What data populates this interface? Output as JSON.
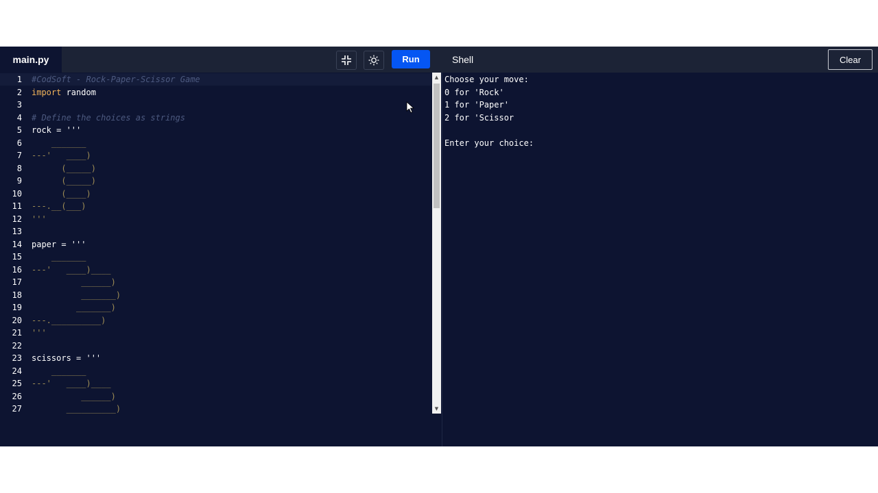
{
  "editor": {
    "file_name": "main.py",
    "lines": [
      {
        "n": "1",
        "t": "#CodSoft - Rock-Paper-Scissor Game",
        "k": "comment",
        "active": true
      },
      {
        "n": "2",
        "t": "",
        "k": "import"
      },
      {
        "n": "3",
        "t": "",
        "k": "plain"
      },
      {
        "n": "4",
        "t": "# Define the choices as strings",
        "k": "comment"
      },
      {
        "n": "5",
        "t": "rock = '''",
        "k": "assign"
      },
      {
        "n": "6",
        "t": "    _______",
        "k": "str"
      },
      {
        "n": "7",
        "t": "---'   ____)",
        "k": "str"
      },
      {
        "n": "8",
        "t": "      (_____)",
        "k": "str"
      },
      {
        "n": "9",
        "t": "      (_____)",
        "k": "str"
      },
      {
        "n": "10",
        "t": "      (____)",
        "k": "str"
      },
      {
        "n": "11",
        "t": "---.__(___)",
        "k": "str"
      },
      {
        "n": "12",
        "t": "'''",
        "k": "str"
      },
      {
        "n": "13",
        "t": "",
        "k": "plain"
      },
      {
        "n": "14",
        "t": "paper = '''",
        "k": "assign"
      },
      {
        "n": "15",
        "t": "    _______",
        "k": "str"
      },
      {
        "n": "16",
        "t": "---'   ____)____",
        "k": "str"
      },
      {
        "n": "17",
        "t": "          ______)",
        "k": "str"
      },
      {
        "n": "18",
        "t": "          _______)",
        "k": "str"
      },
      {
        "n": "19",
        "t": "         _______)",
        "k": "str"
      },
      {
        "n": "20",
        "t": "---.__________)",
        "k": "str"
      },
      {
        "n": "21",
        "t": "'''",
        "k": "str"
      },
      {
        "n": "22",
        "t": "",
        "k": "plain"
      },
      {
        "n": "23",
        "t": "scissors = '''",
        "k": "assign"
      },
      {
        "n": "24",
        "t": "    _______",
        "k": "str"
      },
      {
        "n": "25",
        "t": "---'   ____)____",
        "k": "str"
      },
      {
        "n": "26",
        "t": "          ______)",
        "k": "str"
      },
      {
        "n": "27",
        "t": "       __________)",
        "k": "str"
      }
    ],
    "import_keyword": "import",
    "import_module": " random"
  },
  "toolbar": {
    "run_label": "Run",
    "shell_title": "Shell",
    "clear_label": "Clear",
    "icons": [
      "minimize-icon",
      "theme-sun-icon"
    ]
  },
  "shell": {
    "output": [
      "Choose your move:",
      "0 for 'Rock'",
      "1 for 'Paper'",
      "2 for 'Scissor",
      "",
      "Enter your choice:"
    ]
  },
  "colors": {
    "background": "#0d1431",
    "header": "#1c2336",
    "run_button": "#0556f3",
    "keyword": "#f2b45a",
    "comment": "#4d5a80",
    "string": "#f0e2a5"
  }
}
